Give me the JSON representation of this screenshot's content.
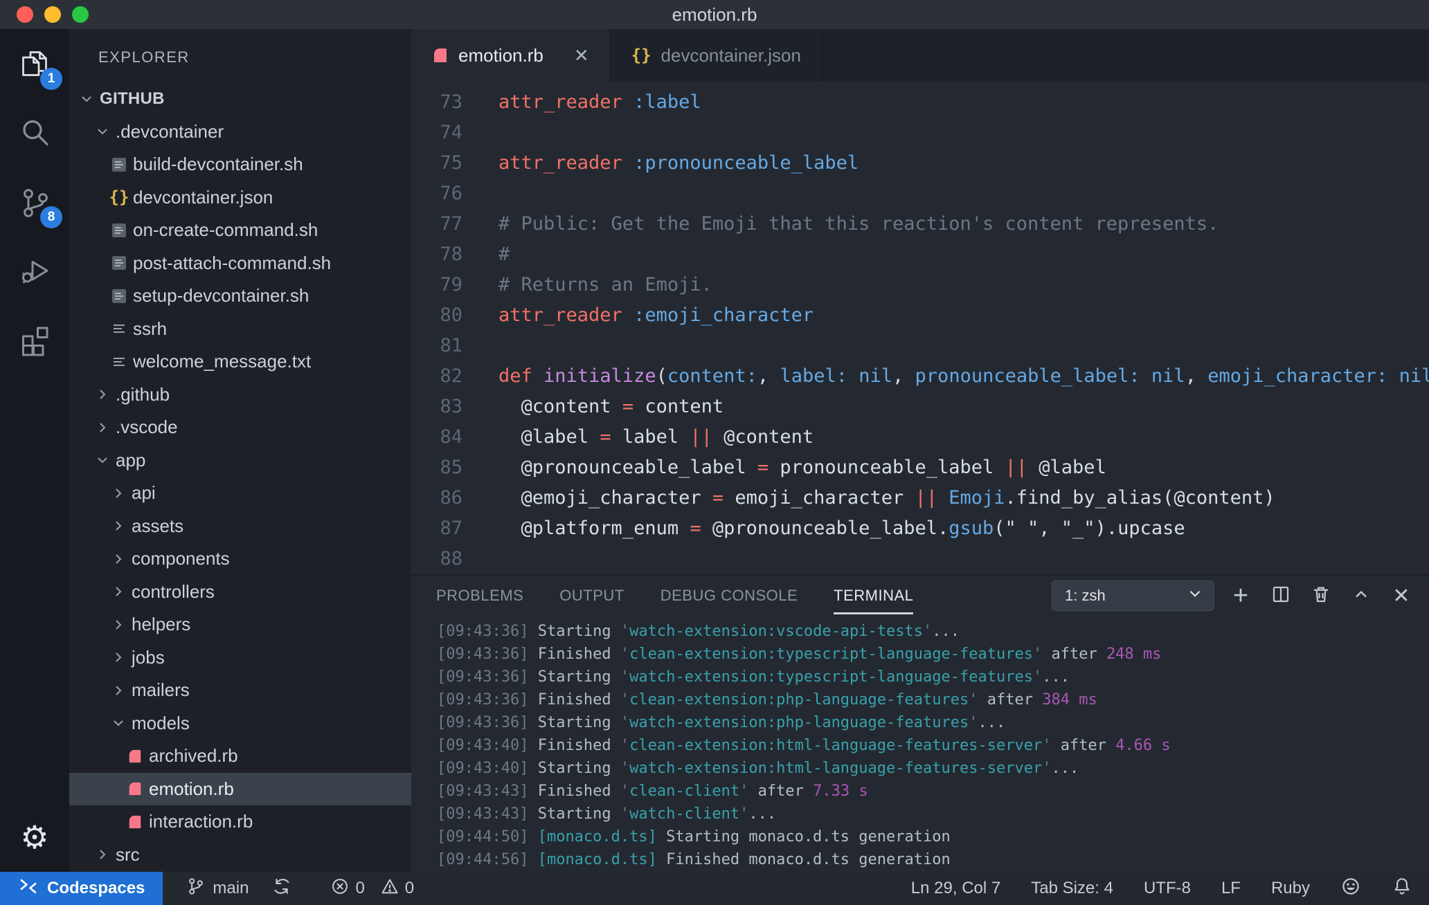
{
  "window": {
    "title": "emotion.rb"
  },
  "colors": {
    "titlebar_bg": "#2c3137",
    "activitybar_bg": "#16191f",
    "sidebar_bg": "#1d2127",
    "editor_bg": "#242931",
    "tabbar_bg": "#1d222a",
    "statusbar_bg": "#23282e",
    "codespaces_blue": "#1f6fd4",
    "badge_blue": "#2b7de0",
    "selected_row": "#3a424c",
    "ruby_pink": "#f8788a",
    "json_yellow": "#e0b64f",
    "syntax_keyword_red": "#f47067",
    "syntax_symbol_blue": "#65a9e5",
    "syntax_function_purple": "#c589e0",
    "syntax_comment_gray": "#6d7784",
    "terminal_task_teal": "#38a1ab",
    "terminal_duration_magenta": "#aa56b4",
    "traffic_red": "#ff5f57",
    "traffic_yellow": "#febc2e",
    "traffic_green": "#28c840"
  },
  "icons": {
    "json": "{}",
    "close": "✕",
    "plus": "+",
    "gear": "⚙"
  },
  "activity_bar": {
    "badges": {
      "explorer": "1",
      "source_control": "8"
    }
  },
  "sidebar": {
    "header": "EXPLORER",
    "tree": [
      {
        "label": "GITHUB",
        "level": 0,
        "type": "root",
        "state": "expanded"
      },
      {
        "label": ".devcontainer",
        "level": 1,
        "type": "folder",
        "state": "expanded"
      },
      {
        "label": "build-devcontainer.sh",
        "level": 2,
        "type": "file",
        "icon": "shell"
      },
      {
        "label": "devcontainer.json",
        "level": 2,
        "type": "file",
        "icon": "json"
      },
      {
        "label": "on-create-command.sh",
        "level": 2,
        "type": "file",
        "icon": "shell"
      },
      {
        "label": "post-attach-command.sh",
        "level": 2,
        "type": "file",
        "icon": "shell"
      },
      {
        "label": "setup-devcontainer.sh",
        "level": 2,
        "type": "file",
        "icon": "shell"
      },
      {
        "label": "ssrh",
        "level": 2,
        "type": "file",
        "icon": "text"
      },
      {
        "label": "welcome_message.txt",
        "level": 2,
        "type": "file",
        "icon": "text"
      },
      {
        "label": ".github",
        "level": 1,
        "type": "folder",
        "state": "collapsed"
      },
      {
        "label": ".vscode",
        "level": 1,
        "type": "folder",
        "state": "collapsed"
      },
      {
        "label": "app",
        "level": 1,
        "type": "folder",
        "state": "expanded"
      },
      {
        "label": "api",
        "level": 2,
        "type": "folder",
        "state": "collapsed"
      },
      {
        "label": "assets",
        "level": 2,
        "type": "folder",
        "state": "collapsed"
      },
      {
        "label": "components",
        "level": 2,
        "type": "folder",
        "state": "collapsed"
      },
      {
        "label": "controllers",
        "level": 2,
        "type": "folder",
        "state": "collapsed"
      },
      {
        "label": "helpers",
        "level": 2,
        "type": "folder",
        "state": "collapsed"
      },
      {
        "label": "jobs",
        "level": 2,
        "type": "folder",
        "state": "collapsed"
      },
      {
        "label": "mailers",
        "level": 2,
        "type": "folder",
        "state": "collapsed"
      },
      {
        "label": "models",
        "level": 2,
        "type": "folder",
        "state": "expanded"
      },
      {
        "label": "archived.rb",
        "level": 3,
        "type": "file",
        "icon": "ruby"
      },
      {
        "label": "emotion.rb",
        "level": 3,
        "type": "file",
        "icon": "ruby",
        "selected": true
      },
      {
        "label": "interaction.rb",
        "level": 3,
        "type": "file",
        "icon": "ruby"
      },
      {
        "label": "src",
        "level": 1,
        "type": "folder",
        "state": "collapsed"
      }
    ]
  },
  "editor": {
    "tabs": [
      {
        "label": "emotion.rb",
        "icon": "ruby",
        "active": true,
        "close": "✕"
      },
      {
        "label": "devcontainer.json",
        "icon": "json",
        "active": false
      }
    ],
    "lines": [
      {
        "n": "73",
        "tokens": [
          [
            "r",
            "attr_reader"
          ],
          [
            "w",
            " "
          ],
          [
            "b",
            ":label"
          ]
        ]
      },
      {
        "n": "74",
        "tokens": []
      },
      {
        "n": "75",
        "tokens": [
          [
            "r",
            "attr_reader"
          ],
          [
            "w",
            " "
          ],
          [
            "b",
            ":pronounceable_label"
          ]
        ]
      },
      {
        "n": "76",
        "tokens": []
      },
      {
        "n": "77",
        "tokens": [
          [
            "c",
            "# Public: Get the Emoji that this reaction's content represents."
          ]
        ]
      },
      {
        "n": "78",
        "tokens": [
          [
            "c",
            "#"
          ]
        ]
      },
      {
        "n": "79",
        "tokens": [
          [
            "c",
            "# Returns an Emoji."
          ]
        ]
      },
      {
        "n": "80",
        "tokens": [
          [
            "r",
            "attr_reader"
          ],
          [
            "w",
            " "
          ],
          [
            "b",
            ":emoji_character"
          ]
        ]
      },
      {
        "n": "81",
        "tokens": []
      },
      {
        "n": "82",
        "tokens": [
          [
            "r",
            "def"
          ],
          [
            "w",
            " "
          ],
          [
            "p",
            "initialize"
          ],
          [
            "w",
            "("
          ],
          [
            "b",
            "content:"
          ],
          [
            "w",
            ", "
          ],
          [
            "b",
            "label:"
          ],
          [
            "w",
            " "
          ],
          [
            "b",
            "nil"
          ],
          [
            "w",
            ", "
          ],
          [
            "b",
            "pronounceable_label:"
          ],
          [
            "w",
            " "
          ],
          [
            "b",
            "nil"
          ],
          [
            "w",
            ", "
          ],
          [
            "b",
            "emoji_character:"
          ],
          [
            "w",
            " "
          ],
          [
            "b",
            "nil"
          ],
          [
            "w",
            ")"
          ]
        ]
      },
      {
        "n": "83",
        "tokens": [
          [
            "w",
            "  @content "
          ],
          [
            "r",
            "="
          ],
          [
            "w",
            " content"
          ]
        ]
      },
      {
        "n": "84",
        "tokens": [
          [
            "w",
            "  @label "
          ],
          [
            "r",
            "="
          ],
          [
            "w",
            " label "
          ],
          [
            "r",
            "||"
          ],
          [
            "w",
            " @content"
          ]
        ]
      },
      {
        "n": "85",
        "tokens": [
          [
            "w",
            "  @pronounceable_label "
          ],
          [
            "r",
            "="
          ],
          [
            "w",
            " pronounceable_label "
          ],
          [
            "r",
            "||"
          ],
          [
            "w",
            " @label"
          ]
        ]
      },
      {
        "n": "86",
        "tokens": [
          [
            "w",
            "  @emoji_character "
          ],
          [
            "r",
            "="
          ],
          [
            "w",
            " emoji_character "
          ],
          [
            "r",
            "||"
          ],
          [
            "w",
            " "
          ],
          [
            "b",
            "Emoji"
          ],
          [
            "w",
            ".find_by_alias(@content)"
          ]
        ]
      },
      {
        "n": "87",
        "tokens": [
          [
            "w",
            "  @platform_enum "
          ],
          [
            "r",
            "="
          ],
          [
            "w",
            " @pronounceable_label."
          ],
          [
            "b",
            "gsub"
          ],
          [
            "w",
            "(\" \", \"_\").upcase"
          ]
        ]
      },
      {
        "n": "88",
        "tokens": []
      }
    ]
  },
  "panel": {
    "tabs": [
      "PROBLEMS",
      "OUTPUT",
      "DEBUG CONSOLE",
      "TERMINAL"
    ],
    "active_tab": "TERMINAL",
    "shell_selector": "1: zsh",
    "lines": [
      [
        [
          "d",
          "[09:43:36] "
        ],
        [
          "lt",
          "Starting "
        ],
        [
          "d",
          "'"
        ],
        [
          "t",
          "watch-extension:vscode-api-tests"
        ],
        [
          "d",
          "'"
        ],
        [
          "lt",
          "..."
        ]
      ],
      [
        [
          "d",
          "[09:43:36] "
        ],
        [
          "lt",
          "Finished "
        ],
        [
          "d",
          "'"
        ],
        [
          "t",
          "clean-extension:typescript-language-features"
        ],
        [
          "d",
          "'"
        ],
        [
          "lt",
          " after "
        ],
        [
          "m",
          "248 ms"
        ]
      ],
      [
        [
          "d",
          "[09:43:36] "
        ],
        [
          "lt",
          "Starting "
        ],
        [
          "d",
          "'"
        ],
        [
          "t",
          "watch-extension:typescript-language-features"
        ],
        [
          "d",
          "'"
        ],
        [
          "lt",
          "..."
        ]
      ],
      [
        [
          "d",
          "[09:43:36] "
        ],
        [
          "lt",
          "Finished "
        ],
        [
          "d",
          "'"
        ],
        [
          "t",
          "clean-extension:php-language-features"
        ],
        [
          "d",
          "'"
        ],
        [
          "lt",
          " after "
        ],
        [
          "m",
          "384 ms"
        ]
      ],
      [
        [
          "d",
          "[09:43:36] "
        ],
        [
          "lt",
          "Starting "
        ],
        [
          "d",
          "'"
        ],
        [
          "t",
          "watch-extension:php-language-features"
        ],
        [
          "d",
          "'"
        ],
        [
          "lt",
          "..."
        ]
      ],
      [
        [
          "d",
          "[09:43:40] "
        ],
        [
          "lt",
          "Finished "
        ],
        [
          "d",
          "'"
        ],
        [
          "t",
          "clean-extension:html-language-features-server"
        ],
        [
          "d",
          "'"
        ],
        [
          "lt",
          " after "
        ],
        [
          "m",
          "4.66 s"
        ]
      ],
      [
        [
          "d",
          "[09:43:40] "
        ],
        [
          "lt",
          "Starting "
        ],
        [
          "d",
          "'"
        ],
        [
          "t",
          "watch-extension:html-language-features-server"
        ],
        [
          "d",
          "'"
        ],
        [
          "lt",
          "..."
        ]
      ],
      [
        [
          "d",
          "[09:43:43] "
        ],
        [
          "lt",
          "Finished "
        ],
        [
          "d",
          "'"
        ],
        [
          "t",
          "clean-client"
        ],
        [
          "d",
          "'"
        ],
        [
          "lt",
          " after "
        ],
        [
          "m",
          "7.33 s"
        ]
      ],
      [
        [
          "d",
          "[09:43:43] "
        ],
        [
          "lt",
          "Starting "
        ],
        [
          "d",
          "'"
        ],
        [
          "t",
          "watch-client"
        ],
        [
          "d",
          "'"
        ],
        [
          "lt",
          "..."
        ]
      ],
      [
        [
          "d",
          "[09:44:50] "
        ],
        [
          "t",
          "[monaco.d.ts]"
        ],
        [
          "lt",
          " Starting monaco.d.ts generation"
        ]
      ],
      [
        [
          "d",
          "[09:44:56] "
        ],
        [
          "t",
          "[monaco.d.ts]"
        ],
        [
          "lt",
          " Finished monaco.d.ts generation"
        ]
      ]
    ]
  },
  "status_bar": {
    "codespaces": "Codespaces",
    "branch": "main",
    "errors": "0",
    "warnings": "0",
    "cursor": "Ln 29, Col 7",
    "tab_size": "Tab Size: 4",
    "encoding": "UTF-8",
    "eol": "LF",
    "language": "Ruby"
  }
}
